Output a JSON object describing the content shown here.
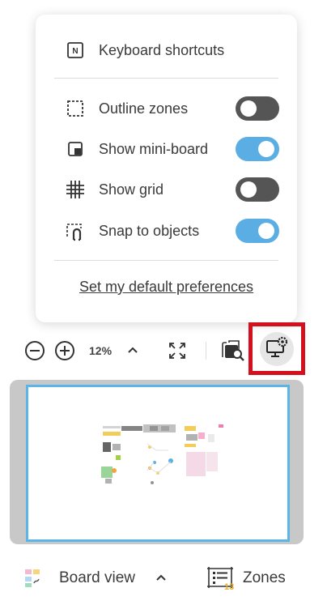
{
  "menu": {
    "shortcuts_label": "Keyboard shortcuts",
    "shortcuts_key": "N",
    "toggles": [
      {
        "label": "Outline zones",
        "state": "off",
        "icon": "outline-zones-icon"
      },
      {
        "label": "Show mini-board",
        "state": "on",
        "icon": "mini-board-icon"
      },
      {
        "label": "Show grid",
        "state": "off",
        "icon": "grid-icon"
      },
      {
        "label": "Snap to objects",
        "state": "on",
        "icon": "snap-icon"
      }
    ],
    "preferences_link": "Set my default preferences"
  },
  "toolbar": {
    "zoom_level": "12%",
    "icons": [
      "zoom-out-icon",
      "zoom-in-icon",
      "chevron-up-icon",
      "fit-screen-icon",
      "find-on-board-icon",
      "display-settings-icon"
    ]
  },
  "bottom": {
    "board_view_label": "Board view",
    "zones_label": "Zones",
    "zones_count": "13"
  },
  "colors": {
    "toggle_on": "#5aaee3",
    "toggle_off": "#555555",
    "highlight": "#d5101d",
    "minimap_border": "#5bb5e6",
    "zones_badge": "#e7b12a"
  }
}
